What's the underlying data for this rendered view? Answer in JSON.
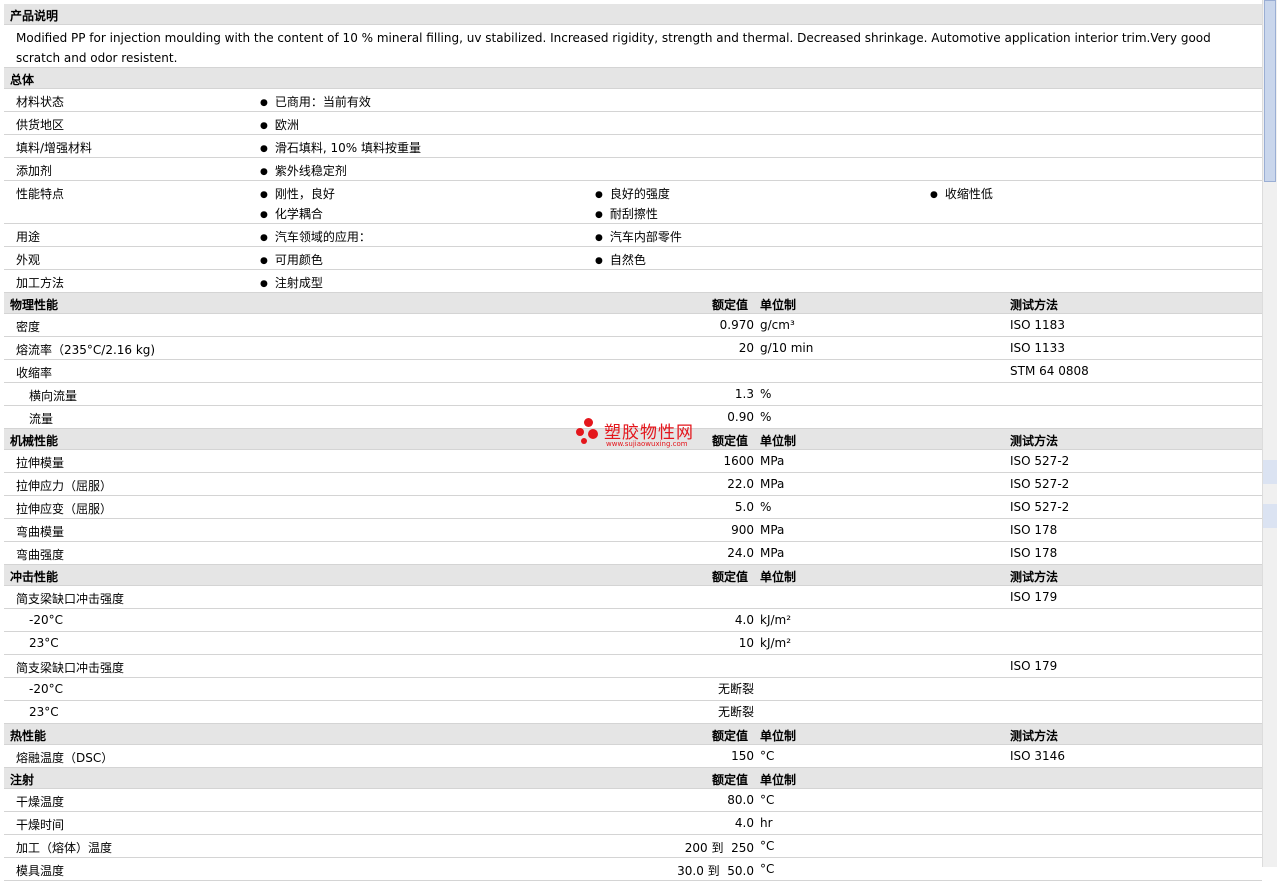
{
  "sections": {
    "description": {
      "title": "产品说明",
      "text": "Modified PP for injection moulding with the content of 10 % mineral filling, uv stabilized. Increased rigidity, strength and thermal. Decreased shrinkage. Automotive application interior trim.Very good scratch and odor resistent."
    },
    "general": {
      "title": "总体",
      "rows": [
        {
          "label": "材料状态",
          "items": [
            "已商用：当前有效"
          ]
        },
        {
          "label": "供货地区",
          "items": [
            "欧洲"
          ]
        },
        {
          "label": "填料/增强材料",
          "items": [
            "滑石填料, 10% 填料按重量"
          ]
        },
        {
          "label": "添加剂",
          "items": [
            "紫外线稳定剂"
          ]
        },
        {
          "label": "性能特点",
          "items": [
            "刚性，良好",
            "良好的强度",
            "收缩性低",
            "化学耦合",
            "耐刮擦性"
          ]
        },
        {
          "label": "用途",
          "items": [
            "汽车领域的应用：",
            "汽车内部零件"
          ]
        },
        {
          "label": "外观",
          "items": [
            "可用颜色",
            "自然色"
          ]
        },
        {
          "label": "加工方法",
          "items": [
            "注射成型"
          ]
        }
      ]
    },
    "header_labels": {
      "value": "额定值",
      "unit": "单位制",
      "method": "测试方法"
    },
    "physical": {
      "title": "物理性能",
      "rows": [
        {
          "label": "密度",
          "value": "0.970",
          "unit": "g/cm³",
          "method": "ISO 1183"
        },
        {
          "label": "熔流率（235°C/2.16 kg)",
          "value": "20",
          "unit": "g/10 min",
          "method": "ISO 1133"
        },
        {
          "label": "收缩率",
          "value": "",
          "unit": "",
          "method": "STM 64 0808"
        },
        {
          "label": "横向流量",
          "value": "1.3",
          "unit": "%",
          "method": ""
        },
        {
          "label": "流量",
          "value": "0.90",
          "unit": "%",
          "method": ""
        }
      ]
    },
    "mechanical": {
      "title": "机械性能",
      "rows": [
        {
          "label": "拉伸模量",
          "value": "1600",
          "unit": "MPa",
          "method": "ISO 527-2"
        },
        {
          "label": "拉伸应力（屈服）",
          "value": "22.0",
          "unit": "MPa",
          "method": "ISO 527-2"
        },
        {
          "label": "拉伸应变（屈服）",
          "value": "5.0",
          "unit": "%",
          "method": "ISO 527-2"
        },
        {
          "label": "弯曲模量",
          "value": "900",
          "unit": "MPa",
          "method": "ISO 178"
        },
        {
          "label": "弯曲强度",
          "value": "24.0",
          "unit": "MPa",
          "method": "ISO 178"
        }
      ]
    },
    "impact": {
      "title": "冲击性能",
      "rows": [
        {
          "label": "简支梁缺口冲击强度",
          "value": "",
          "unit": "",
          "method": "ISO 179"
        },
        {
          "label": "-20°C",
          "value": "4.0",
          "unit": "kJ/m²",
          "method": ""
        },
        {
          "label": "23°C",
          "value": "10",
          "unit": "kJ/m²",
          "method": ""
        },
        {
          "label": "简支梁缺口冲击强度",
          "value": "",
          "unit": "",
          "method": "ISO 179"
        },
        {
          "label": "-20°C",
          "value": "无断裂",
          "unit": "",
          "method": ""
        },
        {
          "label": "23°C",
          "value": "无断裂",
          "unit": "",
          "method": ""
        }
      ]
    },
    "thermal": {
      "title": "热性能",
      "rows": [
        {
          "label": "熔融温度（DSC）",
          "value": "150",
          "unit": "°C",
          "method": "ISO 3146"
        }
      ]
    },
    "injection": {
      "title": "注射",
      "rows": [
        {
          "label": "干燥温度",
          "value": "80.0",
          "unit": "°C",
          "method": ""
        },
        {
          "label": "干燥时间",
          "value": "4.0",
          "unit": "hr",
          "method": ""
        },
        {
          "label": "加工（熔体）温度",
          "value": "200 到  250",
          "unit": "°C",
          "method": ""
        },
        {
          "label": "模具温度",
          "value": "30.0 到  50.0",
          "unit": "°C",
          "method": ""
        }
      ]
    }
  },
  "watermark": {
    "name": "塑胶物性网",
    "url": "www.sujiaowuxing.com"
  },
  "colors": {
    "section_bg": "#e5e5e5",
    "row_border": "#d4d4d4",
    "watermark": "#e4161c"
  }
}
